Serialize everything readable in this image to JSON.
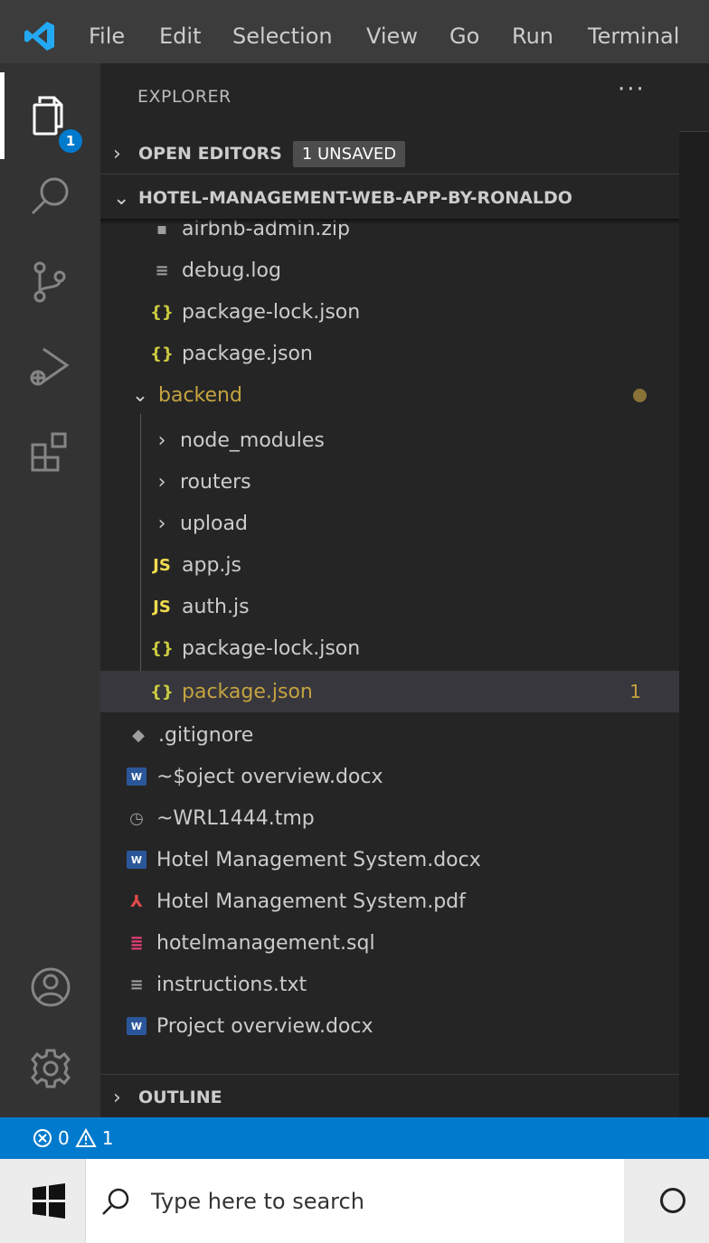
{
  "menubar": {
    "items": [
      "File",
      "Edit",
      "Selection",
      "View",
      "Go",
      "Run",
      "Terminal"
    ]
  },
  "activity": {
    "explorer_badge": "1",
    "icons": [
      "files-icon",
      "search-icon",
      "source-control-icon",
      "run-debug-icon",
      "extensions-icon",
      "account-icon",
      "gear-icon"
    ]
  },
  "explorer": {
    "title": "EXPLORER",
    "more": "···",
    "open_editors": {
      "label": "OPEN EDITORS",
      "badge": "1 UNSAVED"
    },
    "project": {
      "label": "HOTEL-MANAGEMENT-WEB-APP-BY-RONALDO"
    },
    "files": [
      {
        "name": "airbnb-admin.zip",
        "icon": "zip-icon"
      },
      {
        "name": "debug.log",
        "icon": "log-icon"
      },
      {
        "name": "package-lock.json",
        "icon": "json-icon"
      },
      {
        "name": "package.json",
        "icon": "json-icon"
      },
      {
        "name": "backend",
        "icon": "folder-expanded",
        "status": "modified"
      },
      {
        "name": "node_modules",
        "icon": "folder-collapsed"
      },
      {
        "name": "routers",
        "icon": "folder-collapsed"
      },
      {
        "name": "upload",
        "icon": "folder-collapsed"
      },
      {
        "name": "app.js",
        "icon": "js-icon"
      },
      {
        "name": "auth.js",
        "icon": "js-icon"
      },
      {
        "name": "package-lock.json",
        "icon": "json-icon"
      },
      {
        "name": "package.json",
        "icon": "json-icon",
        "problems": "1",
        "selected": true
      },
      {
        "name": ".gitignore",
        "icon": "git-icon"
      },
      {
        "name": "~$oject overview.docx",
        "icon": "word-icon"
      },
      {
        "name": "~WRL1444.tmp",
        "icon": "clock-icon"
      },
      {
        "name": "Hotel Management System.docx",
        "icon": "word-icon"
      },
      {
        "name": "Hotel Management System.pdf",
        "icon": "pdf-icon"
      },
      {
        "name": "hotelmanagement.sql",
        "icon": "database-icon"
      },
      {
        "name": "instructions.txt",
        "icon": "text-icon"
      },
      {
        "name": "Project overview.docx",
        "icon": "word-icon"
      }
    ],
    "outline": {
      "label": "OUTLINE"
    }
  },
  "statusbar": {
    "errors": "0",
    "warnings": "1"
  },
  "taskbar": {
    "search_placeholder": "Type here to search"
  },
  "colors": {
    "accent": "#007acc",
    "modified": "#c5a340"
  }
}
